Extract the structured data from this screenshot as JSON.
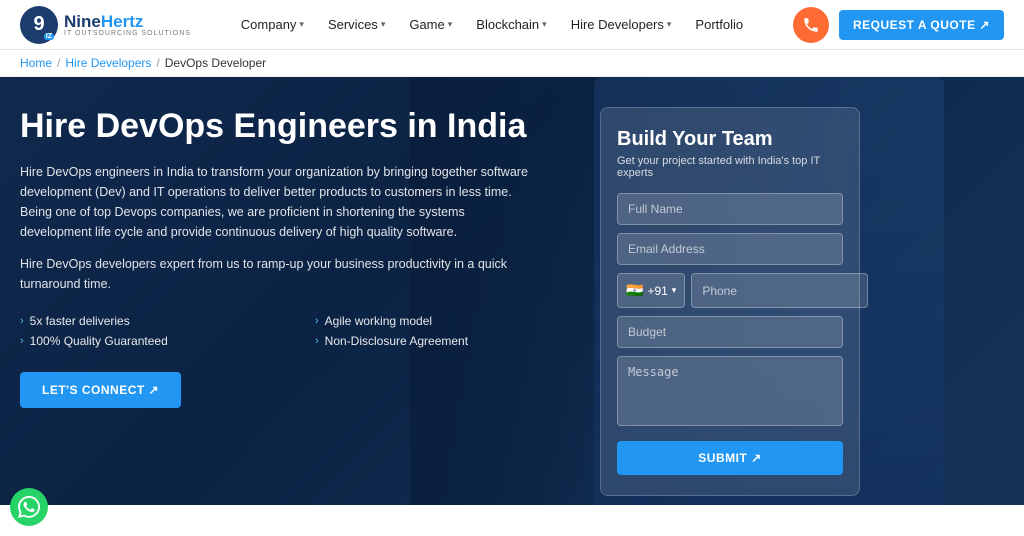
{
  "logo": {
    "nine": "Nine",
    "hertz": "Hertz",
    "sub": "IT Outsourcing Solutions",
    "initial": "9"
  },
  "navbar": {
    "items": [
      {
        "label": "Company",
        "hasDropdown": true
      },
      {
        "label": "Services",
        "hasDropdown": true
      },
      {
        "label": "Game",
        "hasDropdown": true
      },
      {
        "label": "Blockchain",
        "hasDropdown": true
      },
      {
        "label": "Hire Developers",
        "hasDropdown": true
      },
      {
        "label": "Portfolio",
        "hasDropdown": false
      }
    ],
    "quote_label": "REQUEST A QUOTE ↗"
  },
  "breadcrumb": {
    "home": "Home",
    "hire_developers": "Hire Developers",
    "current": "DevOps Developer"
  },
  "hero": {
    "title": "Hire DevOps Engineers in India",
    "description1": "Hire DevOps engineers in India to transform your organization by bringing together software development (Dev) and IT operations to deliver better products to customers in less time. Being one of top Devops companies, we are proficient in shortening the systems development life cycle and provide continuous delivery of high quality software.",
    "description2": "Hire DevOps developers expert from us to ramp-up your business productivity in a quick turnaround time.",
    "features": [
      "5x faster deliveries",
      "Agile working model",
      "100% Quality Guaranteed",
      "Non-Disclosure Agreement"
    ],
    "connect_btn": "LET'S CONNECT ↗"
  },
  "form": {
    "title": "Build Your Team",
    "subtitle": "Get your project started with India's top IT experts",
    "full_name_placeholder": "Full Name",
    "email_placeholder": "Email Address",
    "country_code": "+91",
    "phone_placeholder": "Phone",
    "budget_placeholder": "Budget",
    "message_placeholder": "Message",
    "submit_label": "SUBMIT ↗",
    "flag": "🇮🇳"
  }
}
